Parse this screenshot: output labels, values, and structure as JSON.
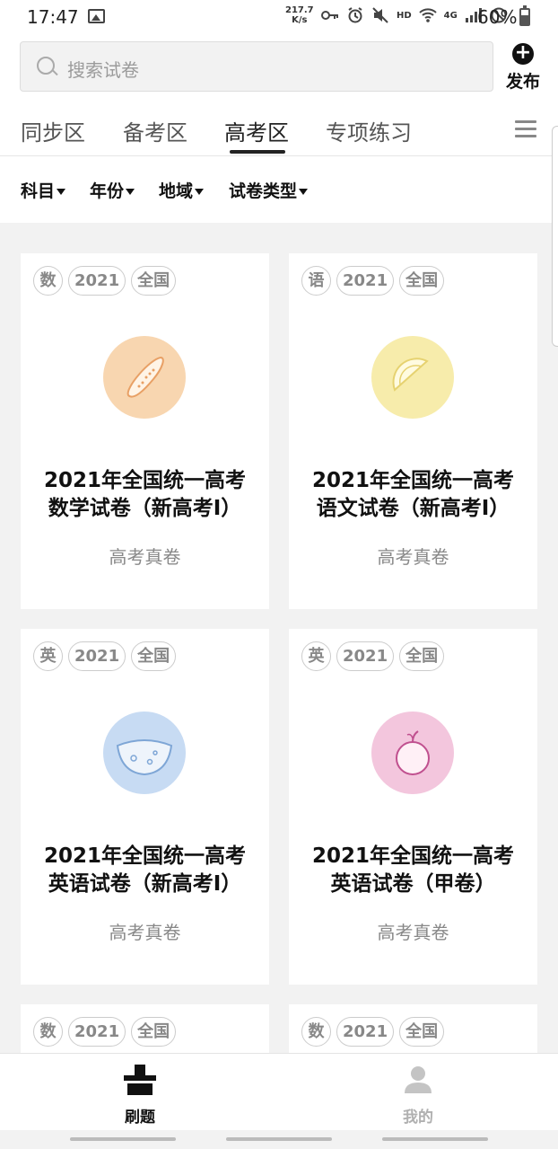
{
  "status": {
    "time": "17:47",
    "speed_value": "217.7",
    "speed_unit": "K/s",
    "hd": "HD",
    "network": "4G",
    "battery": "60%"
  },
  "search": {
    "placeholder": "搜索试卷"
  },
  "publish": {
    "label": "发布"
  },
  "tabs": [
    {
      "label": "同步区"
    },
    {
      "label": "备考区"
    },
    {
      "label": "高考区"
    },
    {
      "label": "专项练习"
    }
  ],
  "filters": [
    {
      "label": "科目"
    },
    {
      "label": "年份"
    },
    {
      "label": "地域"
    },
    {
      "label": "试卷类型"
    }
  ],
  "cards": [
    {
      "tags": [
        "数",
        "2021",
        "全国"
      ],
      "title_line1": "2021年全国统一高考",
      "title_line2": "数学试卷（新高考I）",
      "subtitle": "高考真卷",
      "icon": "cucumber-icon",
      "color": "#f8d6b0"
    },
    {
      "tags": [
        "语",
        "2021",
        "全国"
      ],
      "title_line1": "2021年全国统一高考",
      "title_line2": "语文试卷（新高考I）",
      "subtitle": "高考真卷",
      "icon": "lemon-slice-icon",
      "color": "#f7ecab"
    },
    {
      "tags": [
        "英",
        "2021",
        "全国"
      ],
      "title_line1": "2021年全国统一高考",
      "title_line2": "英语试卷（新高考I）",
      "subtitle": "高考真卷",
      "icon": "cheese-icon",
      "color": "#c7dbf3"
    },
    {
      "tags": [
        "英",
        "2021",
        "全国"
      ],
      "title_line1": "2021年全国统一高考",
      "title_line2": "英语试卷（甲卷）",
      "subtitle": "高考真卷",
      "icon": "apple-icon",
      "color": "#f3c6dd"
    },
    {
      "tags": [
        "数",
        "2021",
        "全国"
      ]
    },
    {
      "tags": [
        "数",
        "2021",
        "全国"
      ]
    }
  ],
  "nav": [
    {
      "label": "刷题",
      "icon": "quiz-icon",
      "active": true
    },
    {
      "label": "我的",
      "icon": "profile-icon",
      "active": false
    }
  ]
}
